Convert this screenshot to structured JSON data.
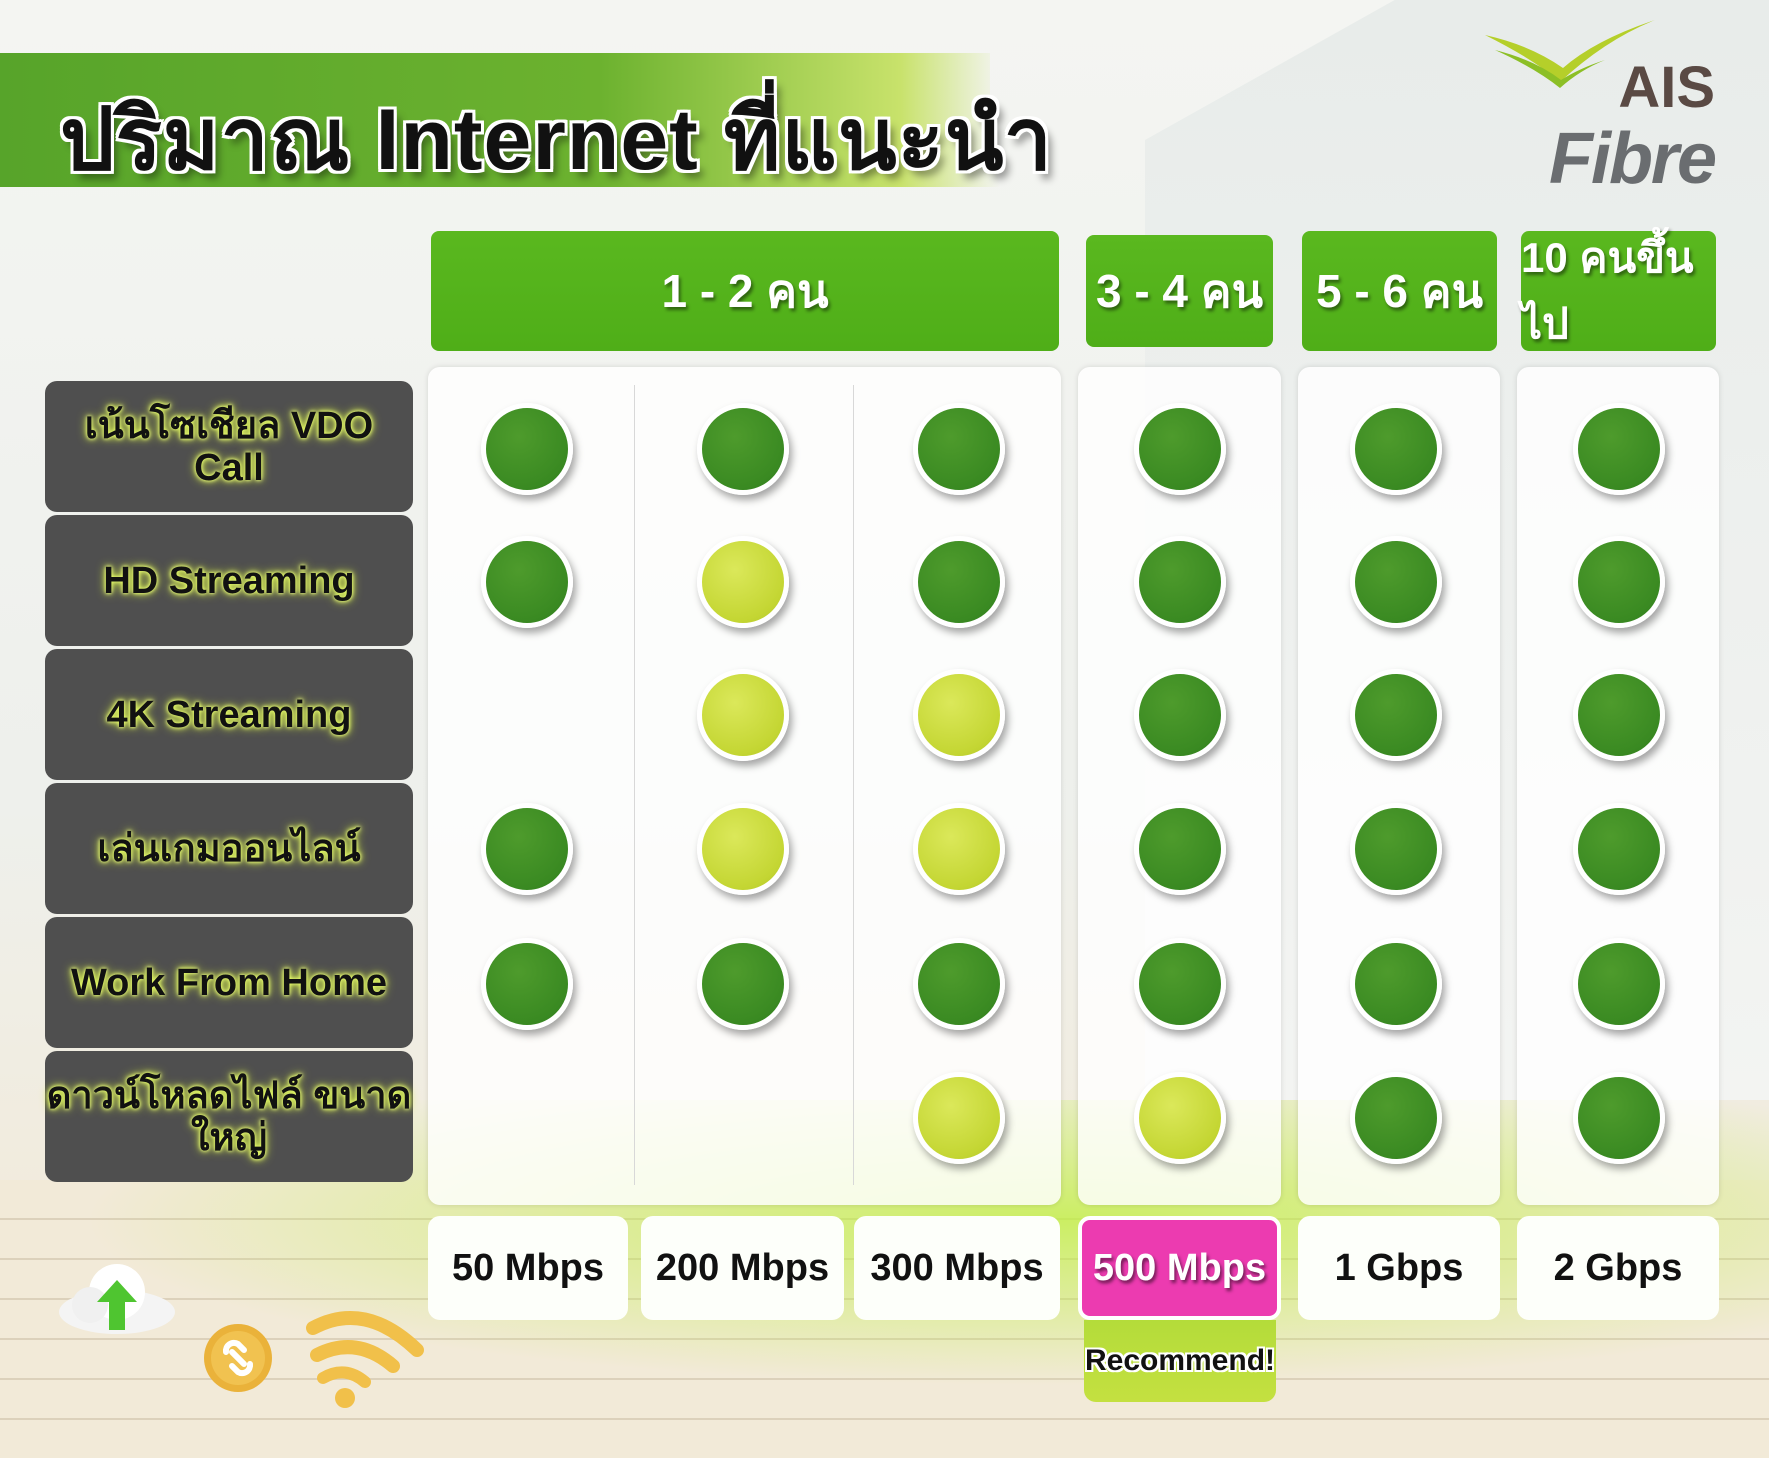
{
  "title": "ปริมาณ Internet ที่แนะนำ",
  "logo": {
    "line1": "AIS",
    "line2": "Fibre"
  },
  "colors": {
    "dark_green": "#3a8a22",
    "yellow_green": "#c4d633",
    "header_green": "#52b11a",
    "highlight_pink": "#ec3bb0"
  },
  "groups": [
    {
      "label": "1 - 2 คน"
    },
    {
      "label": "3 - 4 คน"
    },
    {
      "label": "5 - 6 คน"
    },
    {
      "label": "10 คนขึ้นไป"
    }
  ],
  "rows": [
    {
      "label": "เน้นโซเชียล VDO Call",
      "dots": [
        "g",
        "g",
        "g",
        "g",
        "g",
        "g"
      ]
    },
    {
      "label": "HD Streaming",
      "dots": [
        "g",
        "y",
        "g",
        "g",
        "g",
        "g"
      ]
    },
    {
      "label": "4K Streaming",
      "dots": [
        "",
        "y",
        "y",
        "g",
        "g",
        "g"
      ]
    },
    {
      "label": "เล่นเกมออนไลน์",
      "dots": [
        "g",
        "y",
        "y",
        "g",
        "g",
        "g"
      ]
    },
    {
      "label": "Work From Home",
      "dots": [
        "g",
        "g",
        "g",
        "g",
        "g",
        "g"
      ]
    },
    {
      "label": "ดาวน์โหลดไฟล์ ขนาดใหญ่",
      "dots": [
        "",
        "",
        "y",
        "y",
        "g",
        "g"
      ]
    }
  ],
  "speeds": [
    {
      "label": "50 Mbps"
    },
    {
      "label": "200 Mbps"
    },
    {
      "label": "300 Mbps"
    },
    {
      "label": "500 Mbps",
      "highlighted": true
    },
    {
      "label": "1 Gbps"
    },
    {
      "label": "2 Gbps"
    }
  ],
  "recommend_label": "Recommend!",
  "icons": [
    "cloud-upload-icon",
    "link-coin-icon",
    "wifi-icon"
  ]
}
